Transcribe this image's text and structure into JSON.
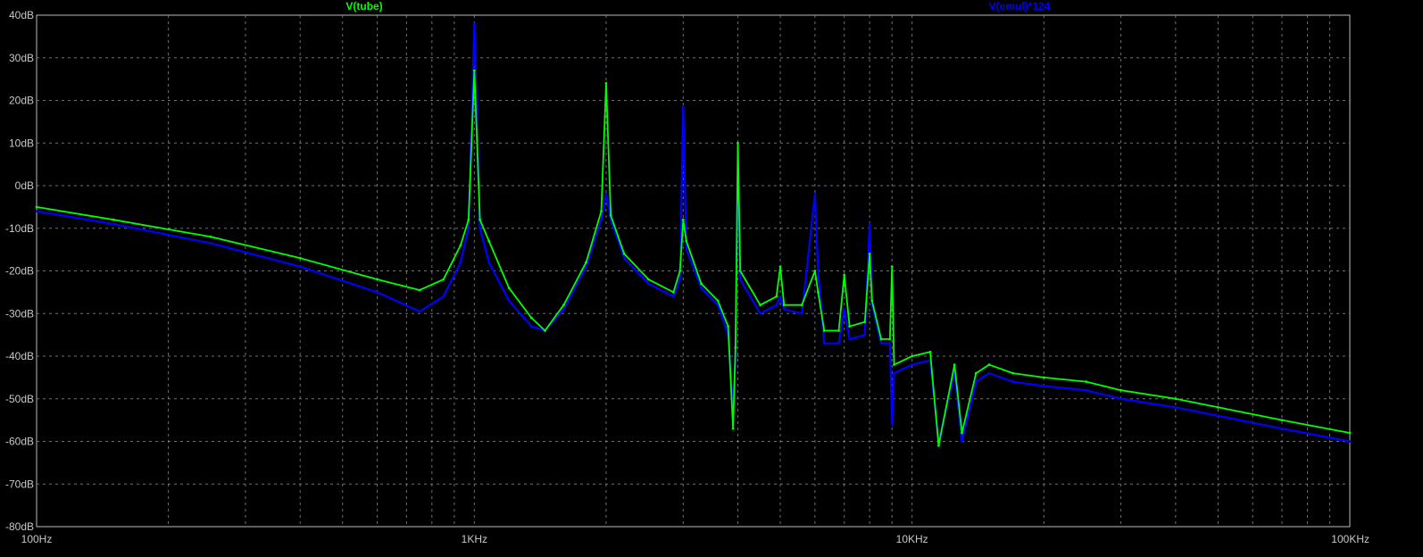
{
  "chart_data": {
    "type": "line",
    "x_scale": "log",
    "xlim": [
      100,
      100000
    ],
    "ylim": [
      -80,
      40
    ],
    "grid": true,
    "background": "#000000",
    "x_ticks": [
      {
        "v": 100,
        "label": "100Hz"
      },
      {
        "v": 1000,
        "label": "1KHz"
      },
      {
        "v": 10000,
        "label": "10KHz"
      },
      {
        "v": 100000,
        "label": "100KHz"
      }
    ],
    "y_ticks": [
      {
        "v": 40,
        "label": "40dB"
      },
      {
        "v": 30,
        "label": "30dB"
      },
      {
        "v": 20,
        "label": "20dB"
      },
      {
        "v": 10,
        "label": "10dB"
      },
      {
        "v": 0,
        "label": "0dB"
      },
      {
        "v": -10,
        "label": "-10dB"
      },
      {
        "v": -20,
        "label": "-20dB"
      },
      {
        "v": -30,
        "label": "-30dB"
      },
      {
        "v": -40,
        "label": "-40dB"
      },
      {
        "v": -50,
        "label": "-50dB"
      },
      {
        "v": -60,
        "label": "-60dB"
      },
      {
        "v": -70,
        "label": "-70dB"
      },
      {
        "v": -80,
        "label": "-80dB"
      }
    ],
    "series": [
      {
        "name": "V(emul)*124",
        "color": "#0000ff",
        "points": [
          [
            100,
            -6
          ],
          [
            150,
            -9
          ],
          [
            250,
            -13.5
          ],
          [
            400,
            -19
          ],
          [
            600,
            -25
          ],
          [
            750,
            -29.5
          ],
          [
            850,
            -26
          ],
          [
            930,
            -18
          ],
          [
            970,
            -10
          ],
          [
            1000,
            38
          ],
          [
            1030,
            -10
          ],
          [
            1080,
            -18
          ],
          [
            1200,
            -27
          ],
          [
            1350,
            -33
          ],
          [
            1450,
            -34
          ],
          [
            1600,
            -29
          ],
          [
            1800,
            -19
          ],
          [
            1950,
            -8
          ],
          [
            2000,
            -2
          ],
          [
            2050,
            -8
          ],
          [
            2200,
            -17
          ],
          [
            2500,
            -23
          ],
          [
            2850,
            -26
          ],
          [
            2950,
            -22
          ],
          [
            3000,
            18.5
          ],
          [
            3050,
            -15
          ],
          [
            3300,
            -24
          ],
          [
            3600,
            -28
          ],
          [
            3800,
            -35
          ],
          [
            3900,
            -52
          ],
          [
            3950,
            -40
          ],
          [
            4000,
            5
          ],
          [
            4050,
            -22
          ],
          [
            4500,
            -30
          ],
          [
            4900,
            -28
          ],
          [
            5000,
            -26
          ],
          [
            5100,
            -29
          ],
          [
            5600,
            -30
          ],
          [
            6000,
            -2
          ],
          [
            6100,
            -20
          ],
          [
            6300,
            -37
          ],
          [
            6800,
            -37
          ],
          [
            7000,
            -29
          ],
          [
            7200,
            -36
          ],
          [
            7800,
            -35
          ],
          [
            8000,
            -9
          ],
          [
            8100,
            -28
          ],
          [
            8500,
            -37
          ],
          [
            8900,
            -37
          ],
          [
            9000,
            -56
          ],
          [
            9100,
            -44
          ],
          [
            10000,
            -42
          ],
          [
            11000,
            -41
          ],
          [
            11500,
            -60
          ],
          [
            12500,
            -44
          ],
          [
            13000,
            -60
          ],
          [
            14000,
            -46
          ],
          [
            15000,
            -44
          ],
          [
            17000,
            -46
          ],
          [
            20000,
            -47
          ],
          [
            25000,
            -48
          ],
          [
            30000,
            -50
          ],
          [
            40000,
            -52
          ],
          [
            50000,
            -54
          ],
          [
            70000,
            -57
          ],
          [
            100000,
            -60
          ]
        ]
      },
      {
        "name": "V(tube)",
        "color": "#00ff00",
        "points": [
          [
            100,
            -5
          ],
          [
            150,
            -8
          ],
          [
            250,
            -12
          ],
          [
            400,
            -17
          ],
          [
            600,
            -22
          ],
          [
            750,
            -24.5
          ],
          [
            850,
            -22
          ],
          [
            930,
            -14
          ],
          [
            970,
            -8
          ],
          [
            1000,
            27
          ],
          [
            1030,
            -8
          ],
          [
            1080,
            -13
          ],
          [
            1200,
            -24
          ],
          [
            1350,
            -31
          ],
          [
            1450,
            -34
          ],
          [
            1600,
            -28
          ],
          [
            1800,
            -18
          ],
          [
            1950,
            -6
          ],
          [
            2000,
            24
          ],
          [
            2050,
            -7
          ],
          [
            2200,
            -16
          ],
          [
            2500,
            -22
          ],
          [
            2850,
            -25
          ],
          [
            2950,
            -20
          ],
          [
            3000,
            -8
          ],
          [
            3050,
            -13
          ],
          [
            3300,
            -23
          ],
          [
            3600,
            -27
          ],
          [
            3800,
            -33
          ],
          [
            3900,
            -57
          ],
          [
            3950,
            -38
          ],
          [
            4000,
            10
          ],
          [
            4050,
            -20
          ],
          [
            4500,
            -28
          ],
          [
            4900,
            -26
          ],
          [
            5000,
            -19
          ],
          [
            5100,
            -28
          ],
          [
            5600,
            -28
          ],
          [
            6000,
            -20
          ],
          [
            6100,
            -25
          ],
          [
            6300,
            -34
          ],
          [
            6800,
            -34
          ],
          [
            7000,
            -21
          ],
          [
            7200,
            -33
          ],
          [
            7800,
            -32
          ],
          [
            8000,
            -16
          ],
          [
            8100,
            -27
          ],
          [
            8500,
            -36
          ],
          [
            8900,
            -36
          ],
          [
            9000,
            -19
          ],
          [
            9100,
            -42
          ],
          [
            10000,
            -40
          ],
          [
            11000,
            -39
          ],
          [
            11500,
            -61
          ],
          [
            12500,
            -42
          ],
          [
            13000,
            -58
          ],
          [
            14000,
            -44
          ],
          [
            15000,
            -42
          ],
          [
            17000,
            -44
          ],
          [
            20000,
            -45
          ],
          [
            25000,
            -46
          ],
          [
            30000,
            -48
          ],
          [
            40000,
            -50
          ],
          [
            50000,
            -52
          ],
          [
            70000,
            -55
          ],
          [
            100000,
            -58
          ]
        ]
      }
    ]
  }
}
